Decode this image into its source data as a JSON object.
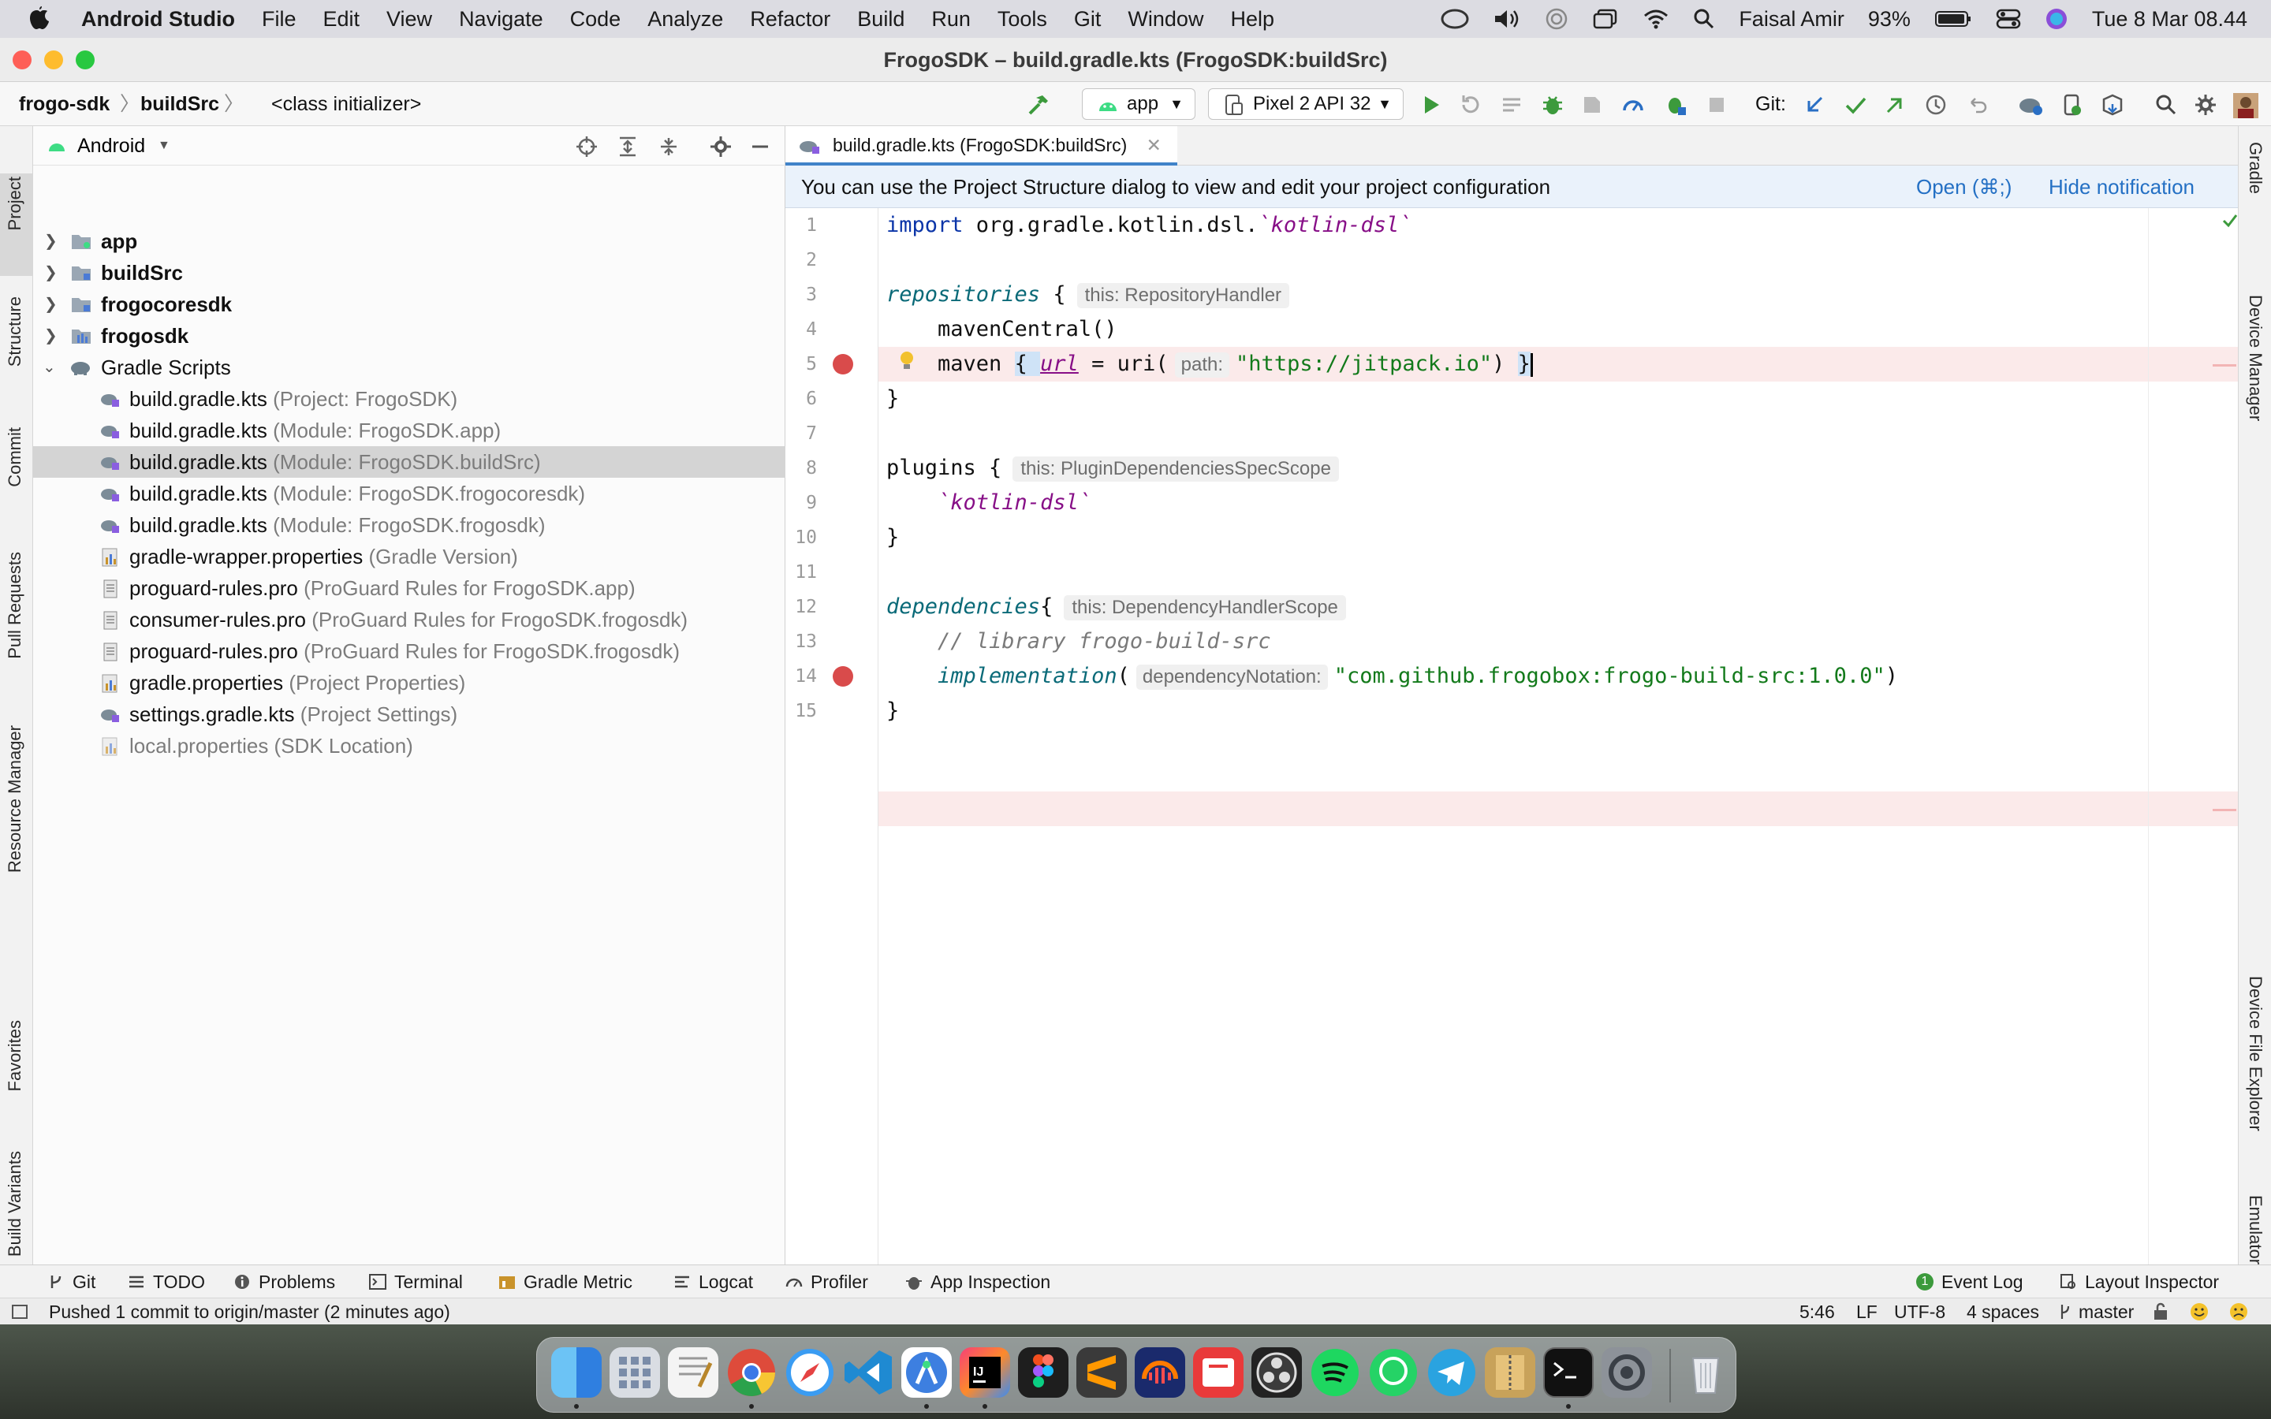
{
  "menubar": {
    "app": "Android Studio",
    "items": [
      "File",
      "Edit",
      "View",
      "Navigate",
      "Code",
      "Analyze",
      "Refactor",
      "Build",
      "Run",
      "Tools",
      "Git",
      "Window",
      "Help"
    ],
    "battery": "93%",
    "user": "Faisal Amir",
    "datetime": "Tue 8 Mar  08.44"
  },
  "window": {
    "title": "FrogoSDK – build.gradle.kts (FrogoSDK:buildSrc)"
  },
  "navbar": {
    "crumbs": [
      "frogo-sdk",
      "buildSrc",
      "<class initializer>"
    ],
    "run_config": "app",
    "device": "Pixel 2 API 32",
    "git_label": "Git:"
  },
  "left_tabs": [
    "Project",
    "Structure",
    "Commit",
    "Pull Requests",
    "Resource Manager",
    "Favorites",
    "Build Variants"
  ],
  "right_tabs": [
    "Gradle",
    "Device Manager",
    "Device File Explorer",
    "Emulator"
  ],
  "project": {
    "view": "Android",
    "tree": [
      {
        "name": "app",
        "hint": "",
        "bold": true,
        "expanded": false
      },
      {
        "name": "buildSrc",
        "hint": "",
        "bold": true,
        "expanded": false
      },
      {
        "name": "frogocoresdk",
        "hint": "",
        "bold": true,
        "expanded": false
      },
      {
        "name": "frogosdk",
        "hint": "",
        "bold": true,
        "expanded": false
      },
      {
        "name": "Gradle Scripts",
        "hint": "",
        "bold": false,
        "expanded": true
      },
      {
        "name": "build.gradle.kts",
        "hint": "(Project: FrogoSDK)"
      },
      {
        "name": "build.gradle.kts",
        "hint": "(Module: FrogoSDK.app)"
      },
      {
        "name": "build.gradle.kts",
        "hint": "(Module: FrogoSDK.buildSrc)",
        "selected": true
      },
      {
        "name": "build.gradle.kts",
        "hint": "(Module: FrogoSDK.frogocoresdk)"
      },
      {
        "name": "build.gradle.kts",
        "hint": "(Module: FrogoSDK.frogosdk)"
      },
      {
        "name": "gradle-wrapper.properties",
        "hint": "(Gradle Version)"
      },
      {
        "name": "proguard-rules.pro",
        "hint": "(ProGuard Rules for FrogoSDK.app)"
      },
      {
        "name": "consumer-rules.pro",
        "hint": "(ProGuard Rules for FrogoSDK.frogosdk)"
      },
      {
        "name": "proguard-rules.pro",
        "hint": "(ProGuard Rules for FrogoSDK.frogosdk)"
      },
      {
        "name": "gradle.properties",
        "hint": "(Project Properties)"
      },
      {
        "name": "settings.gradle.kts",
        "hint": "(Project Settings)"
      },
      {
        "name": "local.properties (SDK Location)",
        "hint": "",
        "dim": true
      }
    ]
  },
  "editor": {
    "tab": "build.gradle.kts (FrogoSDK:buildSrc)",
    "notification": "You can use the Project Structure dialog to view and edit your project configuration",
    "open_link": "Open (⌘;)",
    "hide_link": "Hide notification",
    "line_numbers": [
      "1",
      "2",
      "3",
      "4",
      "5",
      "6",
      "7",
      "8",
      "9",
      "10",
      "11",
      "12",
      "13",
      "14",
      "15"
    ],
    "code": {
      "l1_kw": "import",
      "l1_rest": " org.gradle.kotlin.dsl.",
      "l1_tick": "`kotlin-dsl`",
      "l3_fn": "repositories",
      "l3_brace": " {",
      "l3_hint": "this: RepositoryHandler",
      "l4": "    mavenCentral()",
      "l5_a": "    maven ",
      "l5_b": "{ ",
      "l5_url": "url",
      "l5_c": " = uri(",
      "l5_param": "path:",
      "l5_str": "\"https://jitpack.io\"",
      "l5_d": ") ",
      "l5_e": "}",
      "l6": "}",
      "l8_a": "plugins {",
      "l8_hint": "this: PluginDependenciesSpecScope",
      "l9": "    `kotlin-dsl`",
      "l10": "}",
      "l12_fn": "dependencies",
      "l12_b": "{",
      "l12_hint": "this: DependencyHandlerScope",
      "l13": "    // library frogo-build-src",
      "l14_fn": "implementation",
      "l14_b": "(",
      "l14_param": "dependencyNotation:",
      "l14_str": "\"com.github.frogobox:frogo-build-src:1.0.0\"",
      "l14_c": ")",
      "l15": "}"
    }
  },
  "bottom_tabs": [
    "Git",
    "TODO",
    "Problems",
    "Terminal",
    "Gradle Metric",
    "Logcat",
    "Profiler",
    "App Inspection"
  ],
  "bottom_right_tabs": [
    "Event Log",
    "Layout Inspector"
  ],
  "event_log_count": "1",
  "status": {
    "message": "Pushed 1 commit to origin/master (2 minutes ago)",
    "position": "5:46",
    "line_sep": "LF",
    "encoding": "UTF-8",
    "indent": "4 spaces",
    "branch": "master"
  },
  "dock_apps": [
    "finder",
    "launchpad",
    "textedit",
    "chrome",
    "safari",
    "vscode",
    "android-studio",
    "intellij",
    "figma",
    "sublime",
    "audacity",
    "anydo",
    "obs",
    "spotify",
    "whatsapp",
    "telegram",
    "archive-utility",
    "terminal",
    "system-preferences",
    "trash"
  ]
}
